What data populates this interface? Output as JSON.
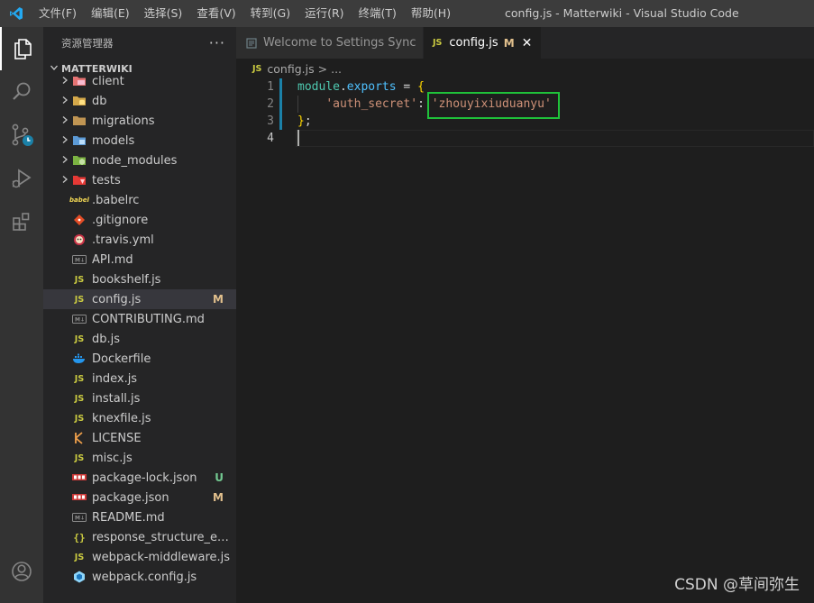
{
  "titlebar": {
    "menu": [
      "文件(F)",
      "编辑(E)",
      "选择(S)",
      "查看(V)",
      "转到(G)",
      "运行(R)",
      "终端(T)",
      "帮助(H)"
    ],
    "window_title": "config.js - Matterwiki - Visual Studio Code"
  },
  "activitybar": {
    "items": [
      "explorer-icon",
      "search-icon",
      "source-control-icon",
      "run-debug-icon",
      "extensions-icon"
    ],
    "bottom": "account-icon"
  },
  "sidebar": {
    "title": "资源管理器",
    "more": "···",
    "section": "MATTERWIKI",
    "items": [
      {
        "name": "client",
        "type": "folder",
        "icon": "client-folder-icon",
        "badge": ""
      },
      {
        "name": "db",
        "type": "folder",
        "icon": "db-folder-icon",
        "badge": ""
      },
      {
        "name": "migrations",
        "type": "folder",
        "icon": "folder-icon",
        "badge": ""
      },
      {
        "name": "models",
        "type": "folder",
        "icon": "models-folder-icon",
        "badge": ""
      },
      {
        "name": "node_modules",
        "type": "folder",
        "icon": "node-folder-icon",
        "badge": ""
      },
      {
        "name": "tests",
        "type": "folder",
        "icon": "tests-folder-icon",
        "badge": ""
      },
      {
        "name": ".babelrc",
        "type": "file",
        "icon": "babel-icon",
        "badge": ""
      },
      {
        "name": ".gitignore",
        "type": "file",
        "icon": "git-icon",
        "badge": ""
      },
      {
        "name": ".travis.yml",
        "type": "file",
        "icon": "travis-icon",
        "badge": ""
      },
      {
        "name": "API.md",
        "type": "file",
        "icon": "markdown-icon",
        "badge": ""
      },
      {
        "name": "bookshelf.js",
        "type": "file",
        "icon": "js-icon",
        "badge": ""
      },
      {
        "name": "config.js",
        "type": "file",
        "icon": "js-icon",
        "badge": "M",
        "selected": true
      },
      {
        "name": "CONTRIBUTING.md",
        "type": "file",
        "icon": "markdown-icon",
        "badge": ""
      },
      {
        "name": "db.js",
        "type": "file",
        "icon": "js-icon",
        "badge": ""
      },
      {
        "name": "Dockerfile",
        "type": "file",
        "icon": "docker-icon",
        "badge": ""
      },
      {
        "name": "index.js",
        "type": "file",
        "icon": "js-icon",
        "badge": ""
      },
      {
        "name": "install.js",
        "type": "file",
        "icon": "js-icon",
        "badge": ""
      },
      {
        "name": "knexfile.js",
        "type": "file",
        "icon": "js-icon",
        "badge": ""
      },
      {
        "name": "LICENSE",
        "type": "file",
        "icon": "license-icon",
        "badge": ""
      },
      {
        "name": "misc.js",
        "type": "file",
        "icon": "js-icon",
        "badge": ""
      },
      {
        "name": "package-lock.json",
        "type": "file",
        "icon": "npm-icon",
        "badge": "U"
      },
      {
        "name": "package.json",
        "type": "file",
        "icon": "npm-icon",
        "badge": "M"
      },
      {
        "name": "README.md",
        "type": "file",
        "icon": "markdown-icon",
        "badge": ""
      },
      {
        "name": "response_structure_exam...",
        "type": "file",
        "icon": "json-icon",
        "badge": ""
      },
      {
        "name": "webpack-middleware.js",
        "type": "file",
        "icon": "js-icon",
        "badge": ""
      },
      {
        "name": "webpack.config.js",
        "type": "file",
        "icon": "webpack-icon",
        "badge": ""
      }
    ]
  },
  "tabs": [
    {
      "label": "Welcome to Settings Sync",
      "active": false
    },
    {
      "label": "config.js",
      "active": true,
      "mark": "M",
      "close": "✕",
      "prefix": "JS"
    }
  ],
  "breadcrumb": {
    "prefix": "JS",
    "file": "config.js",
    "sep": ">",
    "rest": "..."
  },
  "editor": {
    "line_numbers": [
      "1",
      "2",
      "3",
      "4"
    ],
    "lines": [
      {
        "t1": "module",
        "t2": ".",
        "t3": "exports",
        "t4": " = ",
        "t5": "{"
      },
      {
        "indent": "    ",
        "key": "'auth_secret'",
        "colon": ": ",
        "value": "'zhouyixiuduanyu'"
      },
      {
        "close": "}",
        "semi": ";"
      }
    ]
  },
  "watermark": "CSDN @草间弥生"
}
